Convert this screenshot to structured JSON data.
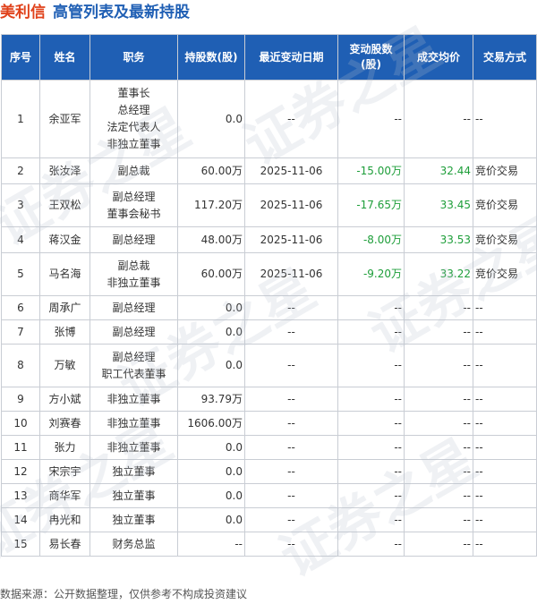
{
  "header": {
    "company": "美利信",
    "subtitle": "高管列表及最新持股"
  },
  "columns": [
    "序号",
    "姓名",
    "职务",
    "持股数\n(股)",
    "最近变动日期",
    "变动股数\n(股)",
    "成交均价",
    "交易方式"
  ],
  "rows": [
    {
      "no": "1",
      "name": "余亚军",
      "roles": [
        "董事长",
        "总经理",
        "法定代表人",
        "非独立董事"
      ],
      "shares": "0.0",
      "date": "--",
      "change": "--",
      "price": "--",
      "method": "--"
    },
    {
      "no": "2",
      "name": "张汝泽",
      "roles": [
        "副总裁"
      ],
      "shares": "60.00万",
      "date": "2025-11-06",
      "change": "-15.00万",
      "price": "32.44",
      "method": "竞价交易"
    },
    {
      "no": "3",
      "name": "王双松",
      "roles": [
        "副总经理",
        "董事会秘书"
      ],
      "shares": "117.20万",
      "date": "2025-11-06",
      "change": "-17.65万",
      "price": "33.45",
      "method": "竞价交易"
    },
    {
      "no": "4",
      "name": "蒋汉金",
      "roles": [
        "副总经理"
      ],
      "shares": "48.00万",
      "date": "2025-11-06",
      "change": "-8.00万",
      "price": "33.53",
      "method": "竞价交易"
    },
    {
      "no": "5",
      "name": "马名海",
      "roles": [
        "副总裁",
        "非独立董事"
      ],
      "shares": "60.00万",
      "date": "2025-11-06",
      "change": "-9.20万",
      "price": "33.22",
      "method": "竞价交易"
    },
    {
      "no": "6",
      "name": "周承广",
      "roles": [
        "副总经理"
      ],
      "shares": "0.0",
      "date": "--",
      "change": "--",
      "price": "--",
      "method": "--"
    },
    {
      "no": "7",
      "name": "张博",
      "roles": [
        "副总经理"
      ],
      "shares": "0.0",
      "date": "--",
      "change": "--",
      "price": "--",
      "method": "--"
    },
    {
      "no": "8",
      "name": "万敏",
      "roles": [
        "副总经理",
        "职工代表董事"
      ],
      "shares": "0.0",
      "date": "--",
      "change": "--",
      "price": "--",
      "method": "--"
    },
    {
      "no": "9",
      "name": "方小斌",
      "roles": [
        "非独立董事"
      ],
      "shares": "93.79万",
      "date": "--",
      "change": "--",
      "price": "--",
      "method": "--"
    },
    {
      "no": "10",
      "name": "刘赛春",
      "roles": [
        "非独立董事"
      ],
      "shares": "1606.00万",
      "date": "--",
      "change": "--",
      "price": "--",
      "method": "--"
    },
    {
      "no": "11",
      "name": "张力",
      "roles": [
        "非独立董事"
      ],
      "shares": "0.0",
      "date": "--",
      "change": "--",
      "price": "--",
      "method": "--"
    },
    {
      "no": "12",
      "name": "宋宗宇",
      "roles": [
        "独立董事"
      ],
      "shares": "0.0",
      "date": "--",
      "change": "--",
      "price": "--",
      "method": "--"
    },
    {
      "no": "13",
      "name": "商华军",
      "roles": [
        "独立董事"
      ],
      "shares": "0.0",
      "date": "--",
      "change": "--",
      "price": "--",
      "method": "--"
    },
    {
      "no": "14",
      "name": "冉光和",
      "roles": [
        "独立董事"
      ],
      "shares": "0.0",
      "date": "--",
      "change": "--",
      "price": "--",
      "method": "--"
    },
    {
      "no": "15",
      "name": "易长春",
      "roles": [
        "财务总监"
      ],
      "shares": "--",
      "date": "--",
      "change": "--",
      "price": "--",
      "method": "--"
    }
  ],
  "footer": "数据来源：公开数据整理，仅供参考不构成投资建议",
  "watermark": "证券之星",
  "colors": {
    "header_bg": "#1f5fb4",
    "company": "#e0421b",
    "negative_change": "#1e9e3a",
    "price": "#1e9e3a"
  }
}
